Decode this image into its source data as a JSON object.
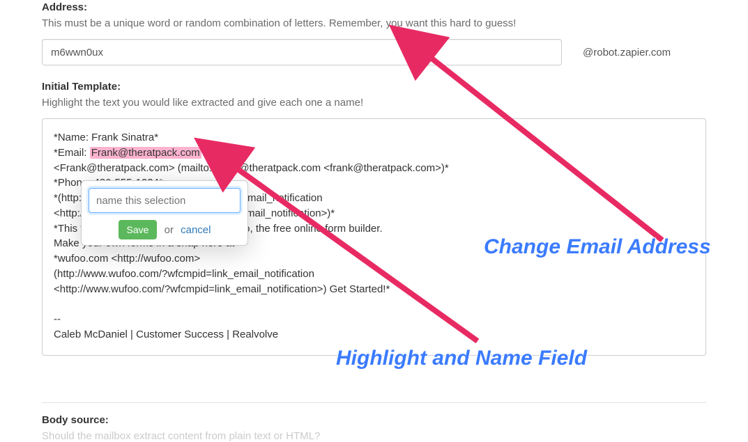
{
  "address": {
    "label": "Address:",
    "help": "This must be a unique word or random combination of letters. Remember, you want this hard to guess!",
    "value": "m6wwn0ux",
    "suffix": "@robot.zapier.com"
  },
  "template": {
    "label": "Initial Template:",
    "help": "Highlight the text you would like extracted and give each one a name!",
    "line1": "*Name: Frank Sinatra*",
    "line2a": "*Email: ",
    "highlighted": "Frank@theratpack.com",
    "line2b": "*",
    "line3": "<Frank@theratpack.com> (mailto:Frank@theratpack.com <frank@theratpack.com>)*",
    "line4": "*Phone: 480-555-1234*",
    "line5": "*(http://www.wufoo.com/?wfcmpid=logo_email_notification",
    "line6": "<http://www.wufoo.com/?wfcmpid=logo_email_notification>)*",
    "line7": "*This form was completed made by Wufoo, the free online form builder.",
    "line8": "Make your own forms in a snap here at*",
    "line9": "*wufoo.com <http://wufoo.com>",
    "line10": "(http://www.wufoo.com/?wfcmpid=link_email_notification",
    "line11": "<http://www.wufoo.com/?wfcmpid=link_email_notification>) Get Started!*",
    "sep": "--",
    "sig": "Caleb McDaniel | Customer Success | Realvolve"
  },
  "popover": {
    "placeholder": "name this selection",
    "save": "Save",
    "or": "or",
    "cancel": "cancel"
  },
  "body_source_label": "Body source:",
  "body_source_help": "Should the mailbox extract content from plain text or HTML?",
  "callouts": {
    "top": "Change Email Address",
    "bottom": "Highlight and Name Field"
  }
}
